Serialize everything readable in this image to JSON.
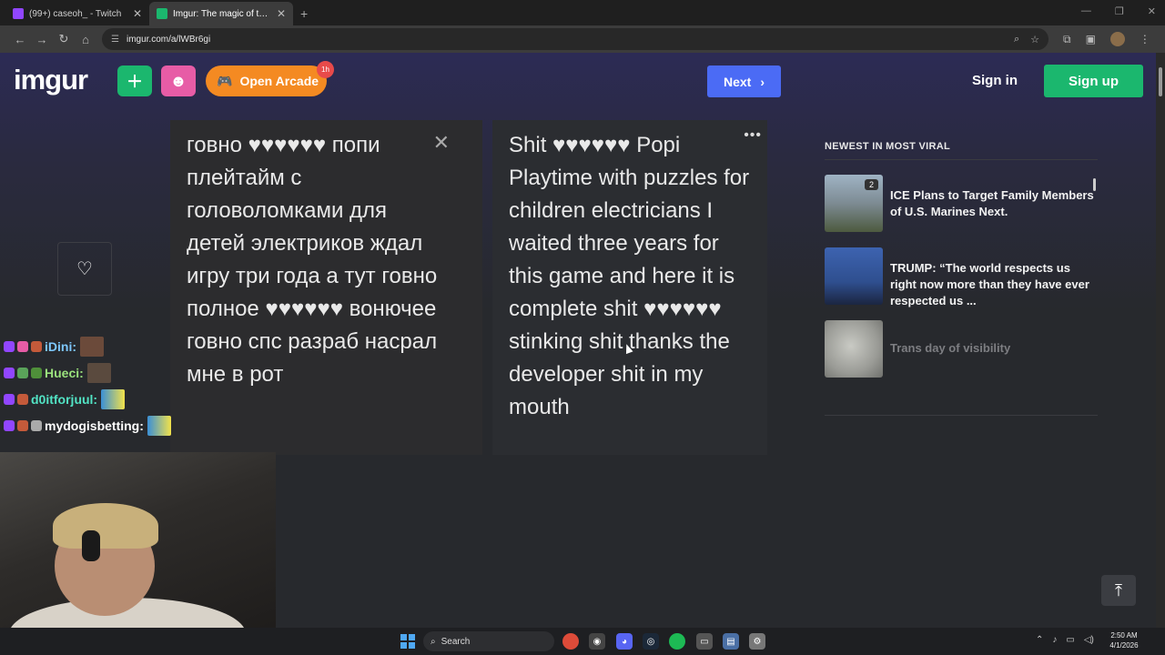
{
  "browser": {
    "tabs": [
      {
        "title": "(99+) caseoh_ - Twitch",
        "favicon_color": "#9146ff",
        "active": false
      },
      {
        "title": "Imgur: The magic of the Interne",
        "favicon_color": "#1bb76e",
        "active": true
      }
    ],
    "url": "imgur.com/a/lWBr6gi"
  },
  "imgur": {
    "logo": "imgur",
    "arcade_label": "Open Arcade",
    "arcade_badge": "1h",
    "next_label": "Next",
    "signin_label": "Sign in",
    "signup_label": "Sign up",
    "post_left_text": "говно ♥♥♥♥♥♥ попи плейтайм с головоломками для детей электриков ждал игру три года а тут говно полное ♥♥♥♥♥♥ вонючее говно спс разраб насрал мне в рот",
    "post_right_text": "Shit ♥♥♥♥♥♥ Popi Playtime with puzzles for children electricians I waited three years for this game and here it is complete shit ♥♥♥♥♥♥ stinking shit thanks the developer shit in my mouth",
    "sidebar_heading": "NEWEST IN MOST VIRAL",
    "viral": [
      {
        "title": "ICE Plans to Target Family Members of U.S. Marines Next.",
        "count": "2",
        "thumb_color": "#7d8b93"
      },
      {
        "title": "TRUMP: “The world respects us right now more than they have ever respected us ...",
        "count": "",
        "thumb_color": "#2f4f8f"
      },
      {
        "title": "Trans day of visibility",
        "count": "",
        "thumb_color": "#9a9b96"
      }
    ]
  },
  "stream": {
    "chat": [
      {
        "user": "iDini:",
        "color": "#7ec8ff"
      },
      {
        "user": "Hueci:",
        "color": "#9be27d"
      },
      {
        "user": "d0itforjuul:",
        "color": "#52e3c4"
      },
      {
        "user": "mydogisbetting:",
        "color": "#ffffff"
      }
    ]
  },
  "taskbar": {
    "search_label": "Search",
    "time": "2:50 AM",
    "date": "4/1/2026"
  }
}
